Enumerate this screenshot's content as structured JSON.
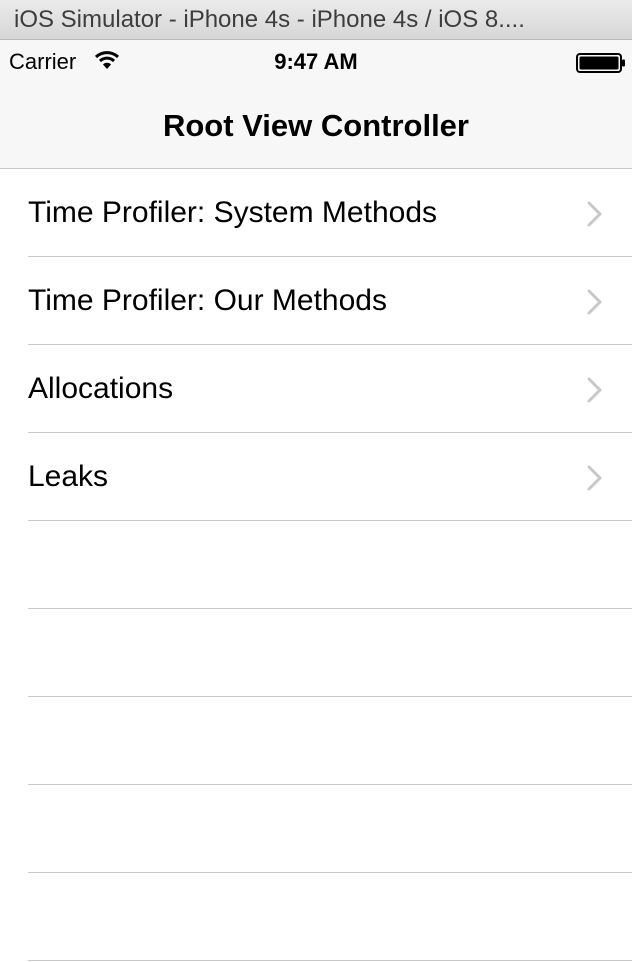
{
  "window": {
    "title": "iOS Simulator - iPhone 4s - iPhone 4s / iOS 8...."
  },
  "status_bar": {
    "carrier": "Carrier",
    "time": "9:47 AM",
    "icons": [
      "wifi-icon",
      "battery-icon"
    ]
  },
  "navbar": {
    "title": "Root View Controller"
  },
  "table": {
    "rows": [
      {
        "label": "Time Profiler: System Methods",
        "icon": "chevron-right-icon"
      },
      {
        "label": "Time Profiler: Our Methods",
        "icon": "chevron-right-icon"
      },
      {
        "label": "Allocations",
        "icon": "chevron-right-icon"
      },
      {
        "label": "Leaks",
        "icon": "chevron-right-icon"
      }
    ],
    "empty_rows": 5
  },
  "colors": {
    "separator": "#c8c7cc",
    "navbar_background": "#f7f7f7",
    "chevron": "#c7c7cc"
  }
}
